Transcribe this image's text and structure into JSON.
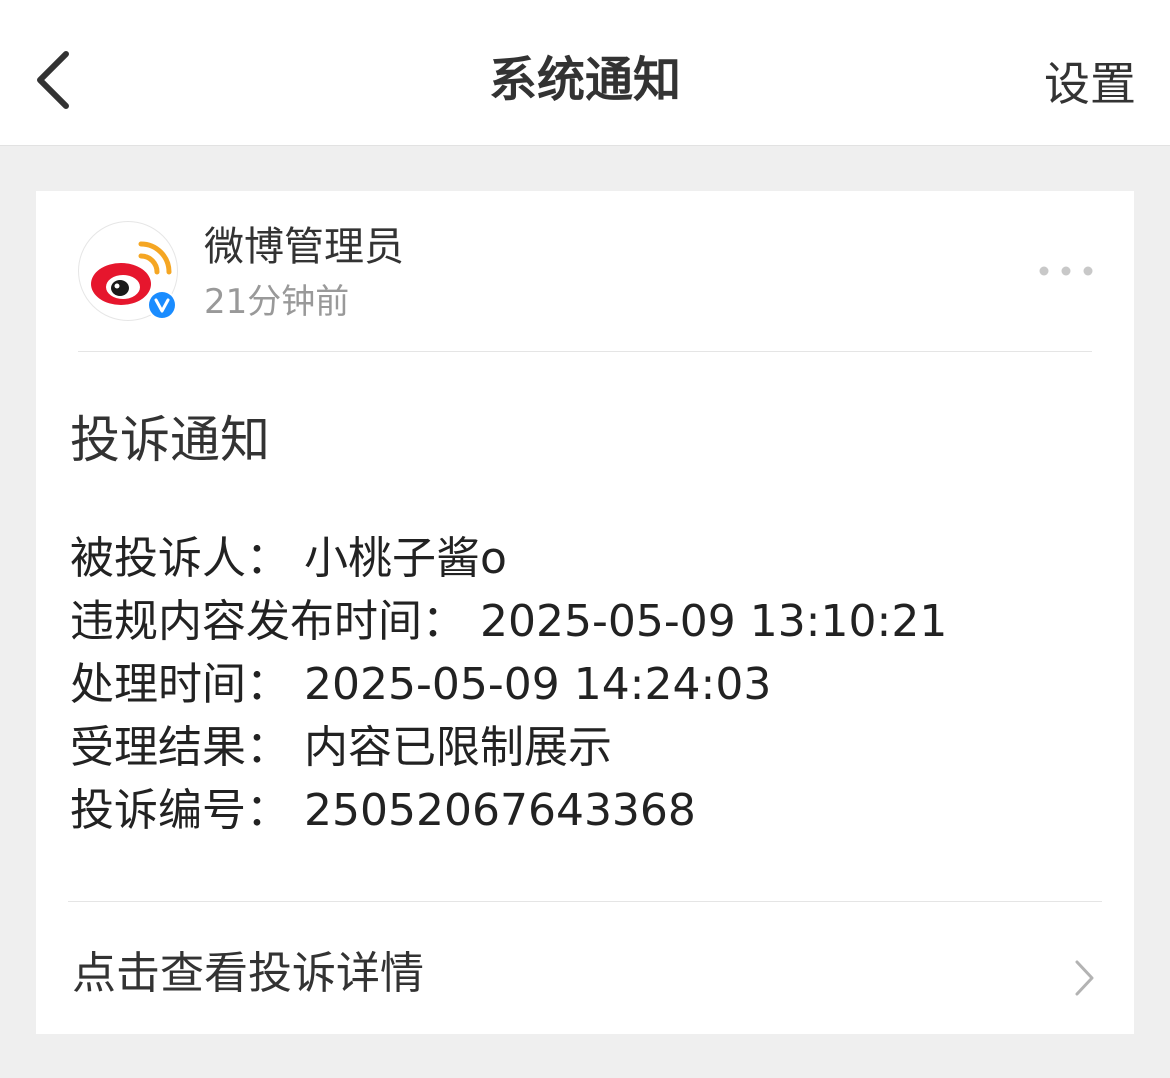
{
  "header": {
    "back_icon": "chevron-left-icon",
    "title": "系统通知",
    "settings_label": "设置"
  },
  "message": {
    "sender": {
      "name": "微博管理员",
      "time": "21分钟前",
      "avatar_icon": "weibo-logo",
      "verified_icon": "verified-v-badge",
      "verified_color": "#1a8cff"
    },
    "more_icon": "ellipsis-icon",
    "title": "投诉通知",
    "details": [
      {
        "label": "被投诉人：",
        "value": "小桃子酱o"
      },
      {
        "label": "违规内容发布时间：",
        "value": "2025-05-09 13:10:21"
      },
      {
        "label": "处理时间：",
        "value": "2025-05-09 14:24:03"
      },
      {
        "label": "受理结果：",
        "value": "内容已限制展示"
      },
      {
        "label": "投诉编号：",
        "value": "25052067643368"
      }
    ],
    "link_label": "点击查看投诉详情",
    "link_icon": "chevron-right-icon"
  },
  "colors": {
    "background": "#efefef",
    "card": "#ffffff",
    "brand_red": "#e6162d",
    "brand_orange": "#f5a623"
  }
}
